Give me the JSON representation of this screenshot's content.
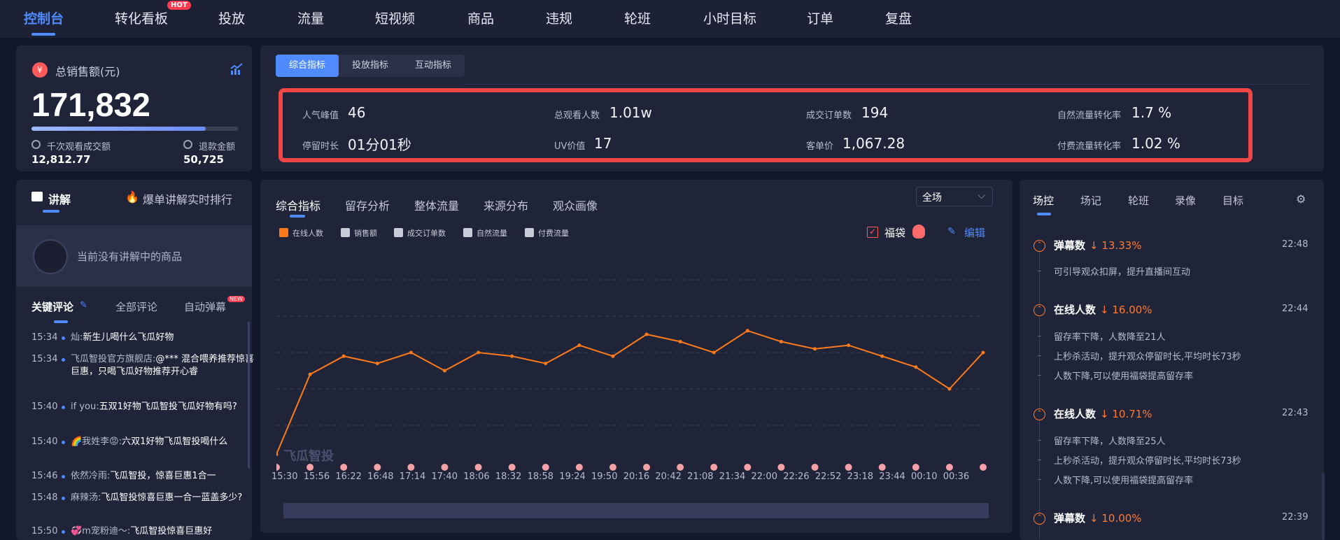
{
  "nav": {
    "items": [
      {
        "label": "控制台"
      },
      {
        "label": "转化看板",
        "badge": "HOT"
      },
      {
        "label": "投放"
      },
      {
        "label": "流量"
      },
      {
        "label": "短视频"
      },
      {
        "label": "商品"
      },
      {
        "label": "违规"
      },
      {
        "label": "轮班"
      },
      {
        "label": "小时目标"
      },
      {
        "label": "订单"
      },
      {
        "label": "复盘"
      }
    ],
    "active_index": 0
  },
  "sales": {
    "title": "总销售额(元)",
    "value": "171,832",
    "progress": 0.84,
    "gpm_label": "千次观看成交额",
    "gpm_value": "12,812.77",
    "refund_label": "退款金额",
    "refund_value": "50,725"
  },
  "metrics": {
    "tabs": [
      "综合指标",
      "投放指标",
      "互动指标"
    ],
    "active_tab": 0,
    "items": [
      {
        "label": "人气峰值",
        "value": "46"
      },
      {
        "label": "总观看人数",
        "value": "1.01w"
      },
      {
        "label": "成交订单数",
        "value": "194"
      },
      {
        "label": "自然流量转化率",
        "value": "1.7 %"
      },
      {
        "label": "停留时长",
        "value": "01分01秒"
      },
      {
        "label": "UV价值",
        "value": "17"
      },
      {
        "label": "客单价",
        "value": "1,067.28"
      },
      {
        "label": "付费流量转化率",
        "value": "1.02 %"
      }
    ]
  },
  "explain": {
    "title": "讲解",
    "rank_link": "爆单讲解实时排行",
    "empty_text": "当前没有讲解中的商品",
    "comment_tabs": [
      "关键评论",
      "全部评论",
      "自动弹幕"
    ],
    "new_badge": "NEW",
    "comments": [
      {
        "time": "15:34",
        "user": "灿:",
        "text": "新生儿喝什么飞瓜好物"
      },
      {
        "time": "15:34",
        "user": "飞瓜智投官方旗舰店:",
        "text": "@*** 混合喂养推荐惊喜巨惠，只喝飞瓜好物推荐开心睿"
      },
      {
        "time": "15:40",
        "user": "if you:",
        "text": "五双1好物飞瓜智投飞瓜好物有吗?"
      },
      {
        "time": "15:40",
        "user": "🌈我姓李😡:",
        "text": "六双1好物飞瓜智投喝什么"
      },
      {
        "time": "15:46",
        "user": "依然冷雨:",
        "text": "飞瓜智投，惊喜巨惠1合一"
      },
      {
        "time": "15:48",
        "user": "麻辣汤:",
        "text": "飞瓜智投惊喜巨惠一合一蓝盖多少?"
      },
      {
        "time": "15:50",
        "user": "💞m宠粉迪～:",
        "text": "飞瓜智投惊喜巨惠好"
      }
    ]
  },
  "chart_panel": {
    "tabs": [
      "综合指标",
      "留存分析",
      "整体流量",
      "来源分布",
      "观众画像"
    ],
    "active_tab": 0,
    "scope": "全场",
    "legend": [
      {
        "name": "在线人数",
        "active": true
      },
      {
        "name": "销售额",
        "active": false
      },
      {
        "name": "成交订单数",
        "active": false
      },
      {
        "name": "自然流量",
        "active": false
      },
      {
        "name": "付费流量",
        "active": false
      }
    ],
    "fudai_label": "福袋",
    "edit_label": "编辑",
    "watermark": "飞瓜智投",
    "colors": {
      "line": "#ff7a1a",
      "markers": "#f4a0a8"
    }
  },
  "chart_data": {
    "type": "line",
    "x": [
      "15:30",
      "15:56",
      "16:22",
      "16:48",
      "17:14",
      "17:40",
      "18:06",
      "18:32",
      "18:58",
      "19:24",
      "19:50",
      "20:16",
      "20:42",
      "21:08",
      "21:34",
      "22:00",
      "22:26",
      "22:52",
      "23:18",
      "23:44",
      "00:10",
      "00:36"
    ],
    "series": [
      {
        "name": "在线人数",
        "values": [
          2,
          24,
          29,
          27,
          30,
          25,
          30,
          29,
          27,
          32,
          29,
          35,
          33,
          30,
          36,
          33,
          31,
          32,
          29,
          26,
          20,
          30
        ]
      }
    ],
    "ylim": [
      0,
      50
    ],
    "grid": true,
    "legend_position": "top-left"
  },
  "right_panel": {
    "tabs": [
      "场控",
      "场记",
      "轮班",
      "录像",
      "目标"
    ],
    "active_tab": 0,
    "events": [
      {
        "title": "弹幕数",
        "change": "↓ 13.33%",
        "time": "22:48",
        "lines": [
          "可引导观众扣屏，提升直播间互动"
        ]
      },
      {
        "title": "在线人数",
        "change": "↓ 16.00%",
        "time": "22:44",
        "lines": [
          "留存率下降，人数降至21人",
          "上秒杀活动，提升观众停留时长,平均时长73秒",
          "人数下降,可以使用福袋提高留存率"
        ]
      },
      {
        "title": "在线人数",
        "change": "↓ 10.71%",
        "time": "22:43",
        "lines": [
          "留存率下降，人数降至25人",
          "上秒杀活动，提升观众停留时长,平均时长73秒",
          "人数下降,可以使用福袋提高留存率"
        ]
      },
      {
        "title": "弹幕数",
        "change": "↓ 10.00%",
        "time": "22:39",
        "lines": []
      }
    ]
  }
}
